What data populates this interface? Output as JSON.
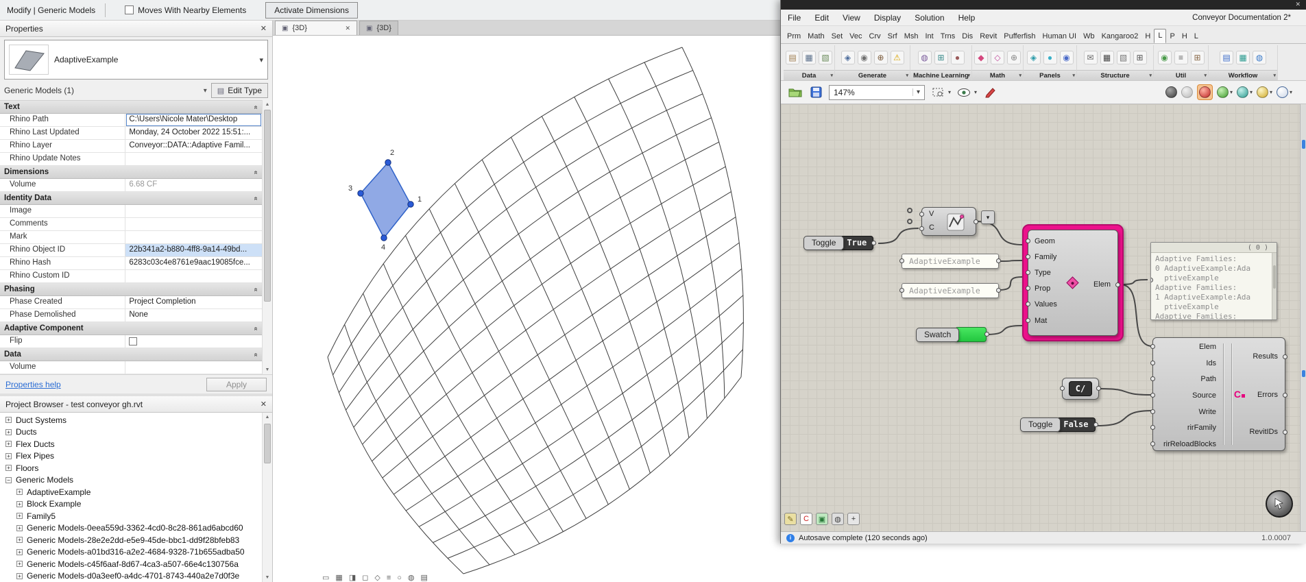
{
  "icons": {
    "close": "✕",
    "dropdown": "▾",
    "collapse_section": "«",
    "expand": "+",
    "collapse": "−",
    "scroll_up": "▲",
    "scroll_down": "▼",
    "cube": "▣",
    "edit_type": "▤",
    "info": "i",
    "conveyor_badge": "C"
  },
  "revit": {
    "modify_bar": {
      "tab_label": "Modify | Generic Models",
      "checkbox_label": "Moves With Nearby Elements",
      "panel_label": "Activate Dimensions"
    },
    "properties": {
      "title": "Properties",
      "type_name": "AdaptiveExample",
      "filter_label": "Generic Models (1)",
      "edit_type_label": "Edit Type",
      "sections": [
        {
          "name": "Text",
          "rows": [
            {
              "label": "Rhino Path",
              "value": "C:\\Users\\Nicole Mater\\Desktop",
              "kind": "edit"
            },
            {
              "label": "Rhino Last Updated",
              "value": "Monday, 24 October 2022 15:51:..."
            },
            {
              "label": "Rhino Layer",
              "value": "Conveyor::DATA::Adaptive Famil..."
            },
            {
              "label": "Rhino Update Notes",
              "value": ""
            }
          ]
        },
        {
          "name": "Dimensions",
          "rows": [
            {
              "label": "Volume",
              "value": "6.68 CF",
              "kind": "muted"
            }
          ]
        },
        {
          "name": "Identity Data",
          "rows": [
            {
              "label": "Image",
              "value": ""
            },
            {
              "label": "Comments",
              "value": ""
            },
            {
              "label": "Mark",
              "value": ""
            },
            {
              "label": "Rhino Object ID",
              "value": "22b341a2-b880-4ff8-9a14-49bd...",
              "kind": "selected"
            },
            {
              "label": "Rhino Hash",
              "value": "6283c03c4e8761e9aac19085fce..."
            },
            {
              "label": "Rhino Custom ID",
              "value": ""
            }
          ]
        },
        {
          "name": "Phasing",
          "rows": [
            {
              "label": "Phase Created",
              "value": "Project Completion"
            },
            {
              "label": "Phase Demolished",
              "value": "None"
            }
          ]
        },
        {
          "name": "Adaptive Component",
          "rows": [
            {
              "label": "Flip",
              "value": "",
              "kind": "checkbox"
            }
          ]
        },
        {
          "name": "Data",
          "rows": [
            {
              "label": "Volume",
              "value": ""
            }
          ]
        }
      ],
      "help_link": "Properties help",
      "apply_label": "Apply"
    },
    "project_browser": {
      "title": "Project Browser - test conveyor gh.rvt",
      "items": [
        {
          "label": "Duct Systems",
          "depth": 0,
          "exp": "+"
        },
        {
          "label": "Ducts",
          "depth": 0,
          "exp": "+"
        },
        {
          "label": "Flex Ducts",
          "depth": 0,
          "exp": "+"
        },
        {
          "label": "Flex Pipes",
          "depth": 0,
          "exp": "+"
        },
        {
          "label": "Floors",
          "depth": 0,
          "exp": "+"
        },
        {
          "label": "Generic Models",
          "depth": 0,
          "exp": "−"
        },
        {
          "label": "AdaptiveExample",
          "depth": 1,
          "exp": "+"
        },
        {
          "label": "Block Example",
          "depth": 1,
          "exp": "+"
        },
        {
          "label": "Family5",
          "depth": 1,
          "exp": "+"
        },
        {
          "label": "Generic Models-0eea559d-3362-4cd0-8c28-861ad6abcd60",
          "depth": 1,
          "exp": "+"
        },
        {
          "label": "Generic Models-28e2e2dd-e5e9-45de-bbc1-dd9f28bfeb83",
          "depth": 1,
          "exp": "+"
        },
        {
          "label": "Generic Models-a01bd316-a2e2-4684-9328-71b655adba50",
          "depth": 1,
          "exp": "+"
        },
        {
          "label": "Generic Models-c45f6aaf-8d67-4ca3-a507-66e4c130756a",
          "depth": 1,
          "exp": "+"
        },
        {
          "label": "Generic Models-d0a3eef0-a4dc-4701-8743-440a2e7d0f3e",
          "depth": 1,
          "exp": "+"
        }
      ]
    },
    "viewport": {
      "tabs": [
        {
          "label": "{3D}",
          "active": true
        },
        {
          "label": "{3D}",
          "active": false
        }
      ],
      "vertex_labels": [
        "1",
        "2",
        "3",
        "4"
      ]
    }
  },
  "grasshopper": {
    "document_title": "Conveyor Documentation 2*",
    "menu": [
      "File",
      "Edit",
      "View",
      "Display",
      "Solution",
      "Help"
    ],
    "tabs": [
      "Prm",
      "Math",
      "Set",
      "Vec",
      "Crv",
      "Srf",
      "Msh",
      "Int",
      "Trns",
      "Dis",
      "Revit",
      "Pufferfish",
      "Human UI",
      "Wb",
      "Kangaroo2",
      "H",
      "L",
      "P",
      "H",
      "L"
    ],
    "active_tab": 16,
    "ribbon_groups": [
      {
        "label": "Data",
        "icons": [
          "database-icon",
          "table-icon",
          "xml-icon"
        ]
      },
      {
        "label": "Generate",
        "icons": [
          "pointer-icon",
          "node-icon",
          "merge-icon",
          "warning-icon"
        ]
      },
      {
        "label": "Machine Learning",
        "icons": [
          "brain-icon",
          "network-icon",
          "sample-icon"
        ]
      },
      {
        "label": "Math",
        "icons": [
          "mesh-icon",
          "flower-icon",
          "gear-icon"
        ]
      },
      {
        "label": "Panels",
        "icons": [
          "diamond-icon",
          "drop-icon",
          "swirl-icon"
        ]
      },
      {
        "label": "Structure",
        "icons": [
          "mail-icon",
          "lattice-icon",
          "hatch-icon",
          "frame-icon"
        ]
      },
      {
        "label": "Util",
        "icons": [
          "pin-icon",
          "wave-icon",
          "clamp-icon"
        ]
      },
      {
        "label": "Workflow",
        "icons": [
          "layers-icon",
          "stack-icon",
          "globe-icon"
        ]
      }
    ],
    "toolbar": {
      "zoom": "147%"
    },
    "canvas": {
      "pipeline": {
        "inputs": [
          "V",
          "C"
        ]
      },
      "toggle_true": {
        "label": "Toggle",
        "value": "True"
      },
      "toggle_false": {
        "label": "Toggle",
        "value": "False"
      },
      "family_panel": {
        "text": "AdaptiveExample"
      },
      "type_panel": {
        "text": "AdaptiveExample"
      },
      "elem_component": {
        "inputs": [
          "Geom",
          "Family",
          "Type",
          "Prop",
          "Values",
          "Mat"
        ],
        "output": "Elem"
      },
      "swatch": {
        "label": "Swatch"
      },
      "data_panel": {
        "count": "( 0 )",
        "lines": [
          "Adaptive Families:",
          "0 AdaptiveExample:Ada",
          "  ptiveExample",
          "Adaptive Families:",
          "1 AdaptiveExample:Ada",
          "  ptiveExample",
          "Adaptive Families:"
        ]
      },
      "script_param": {
        "label": "C/"
      },
      "bake_component": {
        "inputs": [
          "Elem",
          "Ids",
          "Path",
          "Source",
          "Write",
          "rirFamily",
          "rirReloadBlocks"
        ],
        "outputs": [
          "Results",
          "Errors",
          "RevitIDs"
        ]
      }
    },
    "status": {
      "message": "Autosave complete (120 seconds ago)",
      "version": "1.0.0007"
    }
  }
}
